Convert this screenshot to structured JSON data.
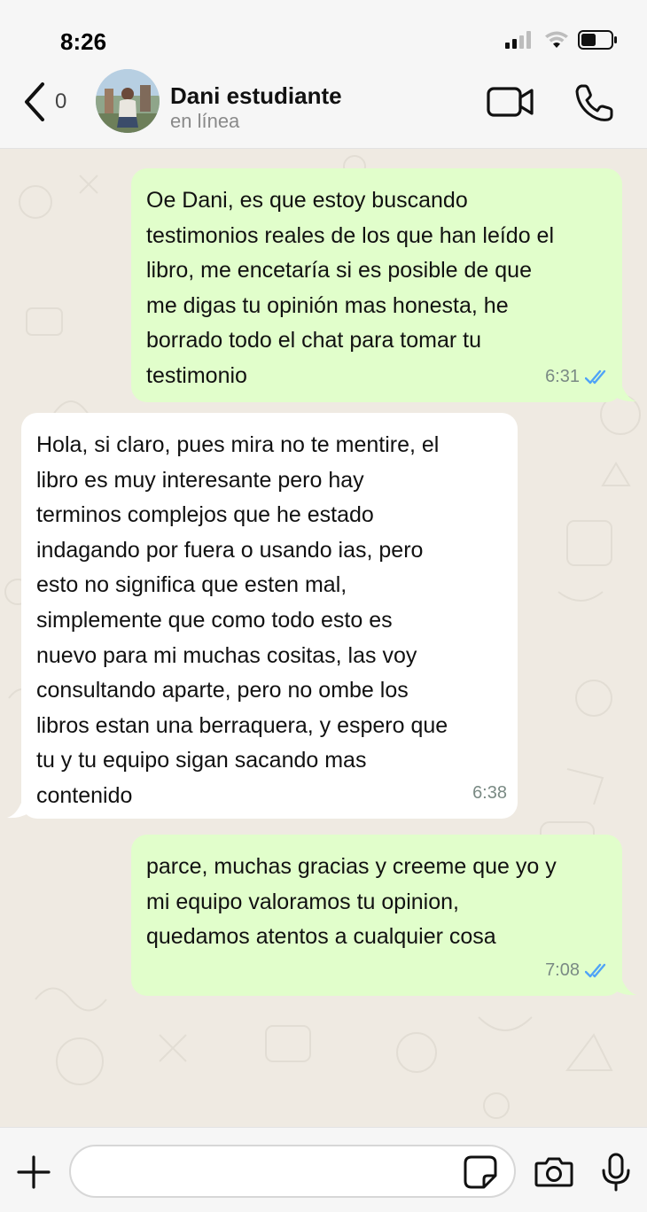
{
  "status_bar": {
    "time": "8:26"
  },
  "header": {
    "back_count": "0",
    "contact_name": "Dani estudiante",
    "contact_status": "en línea"
  },
  "messages": [
    {
      "direction": "out",
      "text": "Oe Dani, es que estoy buscando\ntestimonios reales de los que han leído el\nlibro, me encetaría si es posible de que\nme digas tu opinión mas honesta, he\nborrado todo el chat para tomar tu\ntestimonio",
      "time": "6:31",
      "status": "read"
    },
    {
      "direction": "in",
      "text": "Hola, si claro, pues mira no te mentire, el\nlibro es muy interesante pero hay\nterminos complejos que he estado\nindagando por fuera o usando ias, pero\nesto no significa que esten mal,\nsimplemente que como todo esto es\nnuevo para mi muchas cositas, las voy\nconsultando aparte, pero no ombe los\nlibros estan una berraquera, y espero que\ntu y tu equipo sigan sacando mas\ncontenido",
      "time": "6:38"
    },
    {
      "direction": "out",
      "text": "parce, muchas gracias y creeme que yo y\nmi equipo valoramos tu opinion,\nquedamos atentos a cualquier cosa",
      "time": "7:08",
      "status": "read"
    }
  ],
  "colors": {
    "outgoing_bubble": "#e1fecb",
    "incoming_bubble": "#ffffff",
    "read_ticks": "#4fa3f7",
    "chat_background": "#efeae2"
  },
  "icons": {
    "back": "chevron-left-icon",
    "video_call": "video-camera-icon",
    "voice_call": "phone-icon",
    "attach": "plus-icon",
    "sticker": "sticker-icon",
    "camera": "camera-icon",
    "mic": "microphone-icon"
  }
}
